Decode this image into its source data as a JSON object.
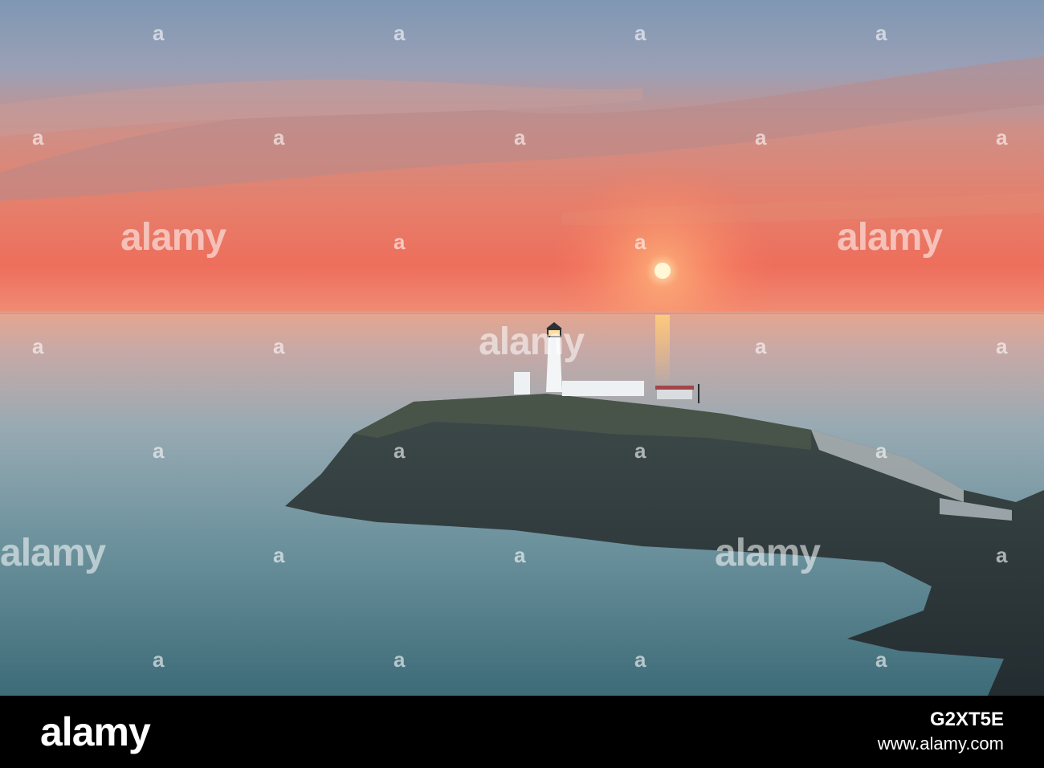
{
  "watermark": {
    "text": "alamy",
    "small_text": "a"
  },
  "footer": {
    "brand": "alamy",
    "image_id": "G2XT5E",
    "url": "www.alamy.com"
  }
}
